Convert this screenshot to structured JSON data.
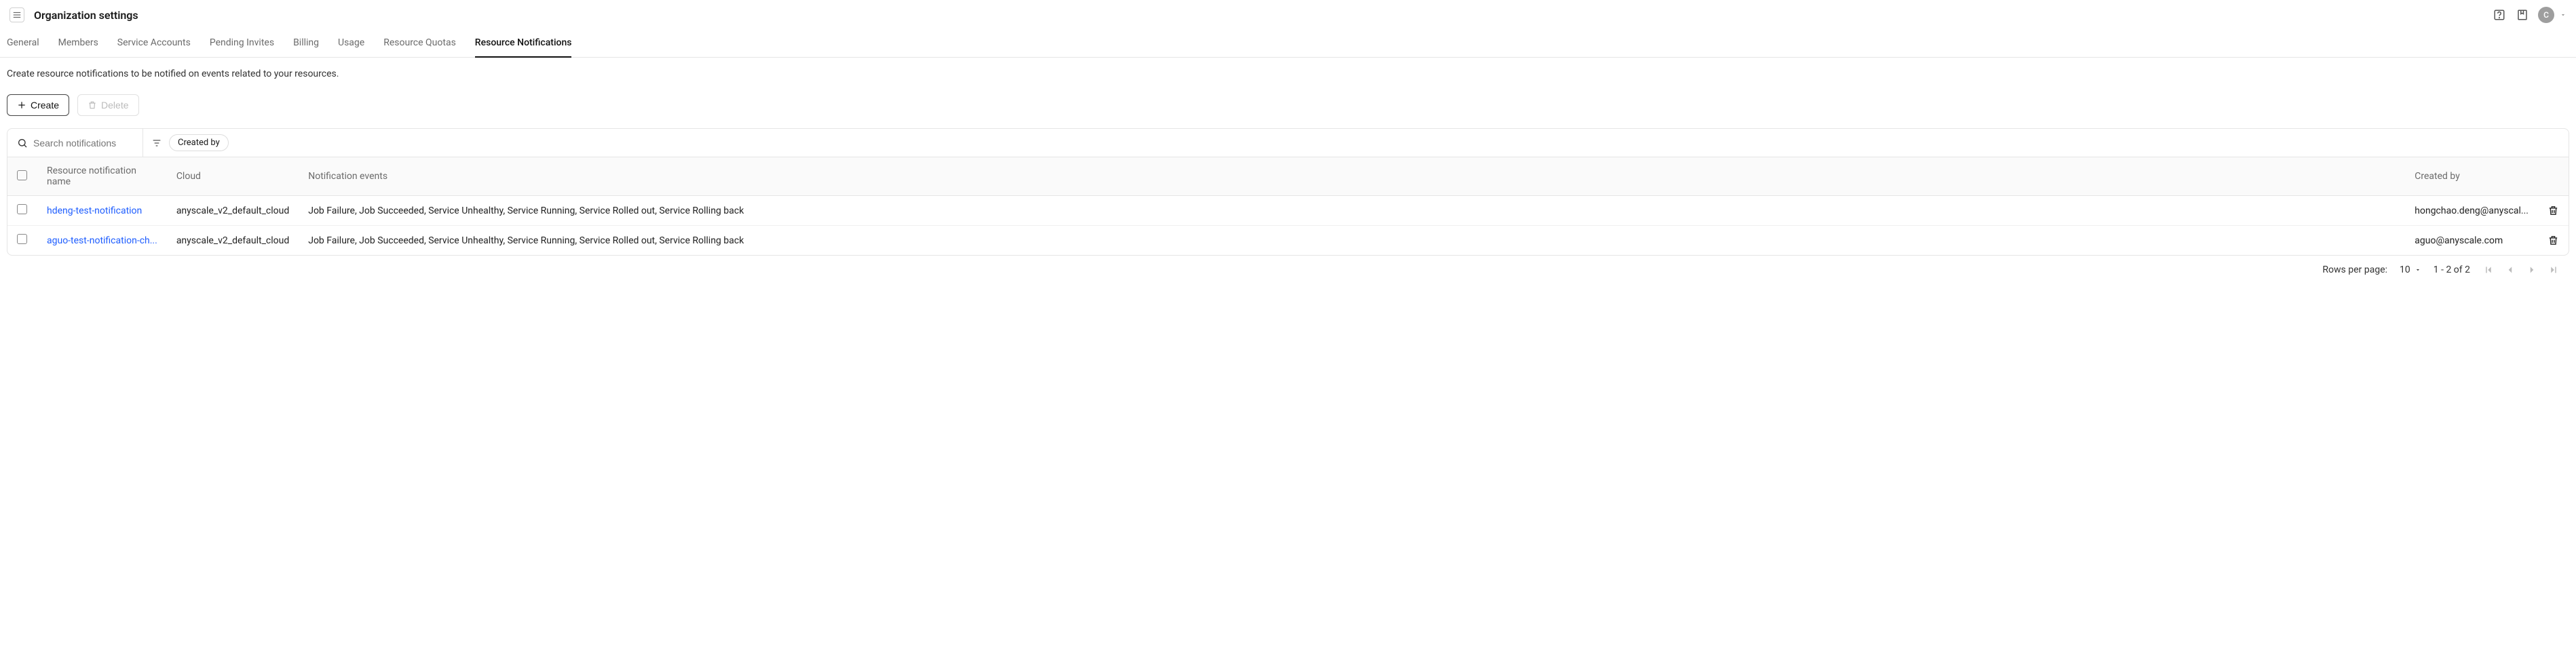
{
  "header": {
    "title": "Organization settings",
    "avatar_initial": "C"
  },
  "tabs": [
    {
      "label": "General",
      "active": false
    },
    {
      "label": "Members",
      "active": false
    },
    {
      "label": "Service Accounts",
      "active": false
    },
    {
      "label": "Pending Invites",
      "active": false
    },
    {
      "label": "Billing",
      "active": false
    },
    {
      "label": "Usage",
      "active": false
    },
    {
      "label": "Resource Quotas",
      "active": false
    },
    {
      "label": "Resource Notifications",
      "active": true
    }
  ],
  "description": "Create resource notifications to be notified on events related to your resources.",
  "buttons": {
    "create": "Create",
    "delete": "Delete"
  },
  "search": {
    "placeholder": "Search notifications"
  },
  "filters": {
    "chip_created_by": "Created by"
  },
  "columns": {
    "name": "Resource notification name",
    "cloud": "Cloud",
    "events": "Notification events",
    "created_by": "Created by"
  },
  "rows": [
    {
      "name": "hdeng-test-notification",
      "cloud": "anyscale_v2_default_cloud",
      "events": "Job Failure, Job Succeeded, Service Unhealthy, Service Running, Service Rolled out, Service Rolling back",
      "created_by": "hongchao.deng@anyscal..."
    },
    {
      "name": "aguo-test-notification-ch...",
      "cloud": "anyscale_v2_default_cloud",
      "events": "Job Failure, Job Succeeded, Service Unhealthy, Service Running, Service Rolled out, Service Rolling back",
      "created_by": "aguo@anyscale.com"
    }
  ],
  "pagination": {
    "rows_per_page_label": "Rows per page:",
    "rows_per_page_value": "10",
    "range": "1 - 2 of 2"
  }
}
